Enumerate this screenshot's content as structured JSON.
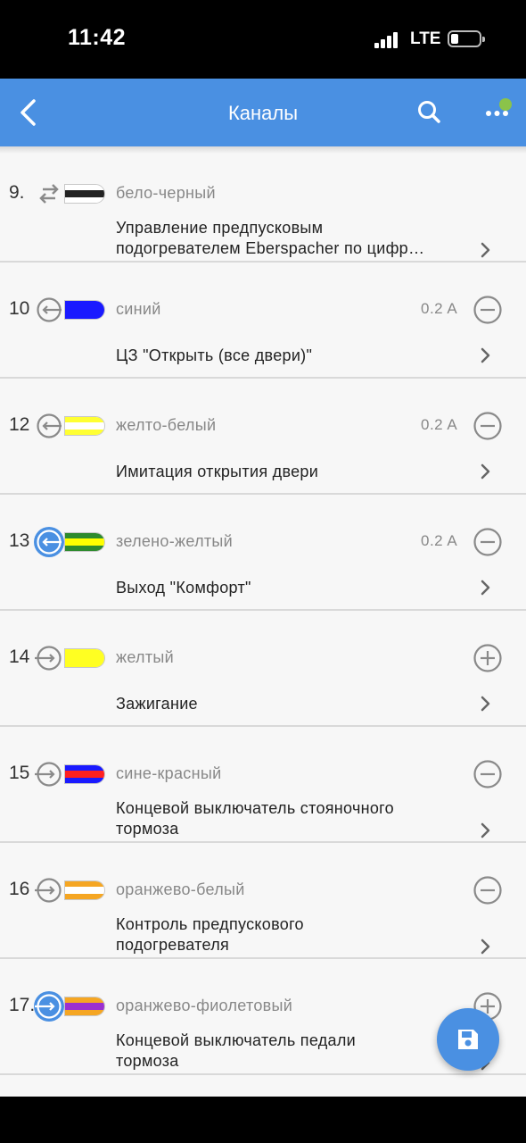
{
  "status_bar": {
    "time": "11:42",
    "network": "LTE"
  },
  "app_bar": {
    "title": "Каналы",
    "back_icon": "chevron-left-icon",
    "search_icon": "search-icon",
    "more_icon": "more-horizontal-icon",
    "notification_dot_color": "#8bc34a"
  },
  "colors": {
    "accent": "#4a90e2",
    "icon_gray": "#8a8a8a"
  },
  "channels": [
    {
      "number": "9.",
      "direction": "bidirectional",
      "active": false,
      "stripes": [
        "#ffffff",
        "#222222",
        "#ffffff"
      ],
      "wire_name": "бело-черный",
      "current": "",
      "toggle": "",
      "description_lines": [
        "Управление предпусковым",
        "подогревателем Eberspacher по цифр…"
      ]
    },
    {
      "number": "10",
      "direction": "output",
      "active": false,
      "stripes": [
        "#1a1aff",
        "#1a1aff",
        "#1a1aff"
      ],
      "wire_name": "синий",
      "current": "0.2 A",
      "toggle": "remove",
      "description_lines": [
        "ЦЗ \"Открыть (все двери)\""
      ]
    },
    {
      "number": "12",
      "direction": "output",
      "active": false,
      "stripes": [
        "#ffff33",
        "#ffffff",
        "#ffff33"
      ],
      "wire_name": "желто-белый",
      "current": "0.2 A",
      "toggle": "remove",
      "description_lines": [
        "Имитация открытия двери"
      ]
    },
    {
      "number": "13",
      "direction": "output",
      "active": true,
      "stripes": [
        "#2e8b2e",
        "#ffff00",
        "#2e8b2e"
      ],
      "wire_name": "зелено-желтый",
      "current": "0.2 A",
      "toggle": "remove",
      "description_lines": [
        "Выход \"Комфорт\""
      ]
    },
    {
      "number": "14",
      "direction": "input",
      "active": false,
      "stripes": [
        "#ffff22",
        "#ffff22",
        "#ffff22"
      ],
      "wire_name": "желтый",
      "current": "",
      "toggle": "add",
      "description_lines": [
        "Зажигание"
      ]
    },
    {
      "number": "15",
      "direction": "input",
      "active": false,
      "stripes": [
        "#1a1aff",
        "#ff2020",
        "#1a1aff"
      ],
      "wire_name": "сине-красный",
      "current": "",
      "toggle": "remove",
      "description_lines": [
        "Концевой выключатель стояночного",
        "тормоза"
      ]
    },
    {
      "number": "16",
      "direction": "input",
      "active": false,
      "stripes": [
        "#f5a623",
        "#ffffff",
        "#f5a623"
      ],
      "wire_name": "оранжево-белый",
      "current": "",
      "toggle": "remove",
      "description_lines": [
        "Контроль предпускового",
        "подогревателя"
      ]
    },
    {
      "number": "17.",
      "direction": "input",
      "active": true,
      "stripes": [
        "#f5a623",
        "#9b30d0",
        "#f5a623"
      ],
      "wire_name": "оранжево-фиолетовый",
      "current": "",
      "toggle": "add",
      "description_lines": [
        "Концевой выключатель педали",
        "тормоза"
      ]
    }
  ],
  "fab": {
    "icon": "save-icon"
  }
}
